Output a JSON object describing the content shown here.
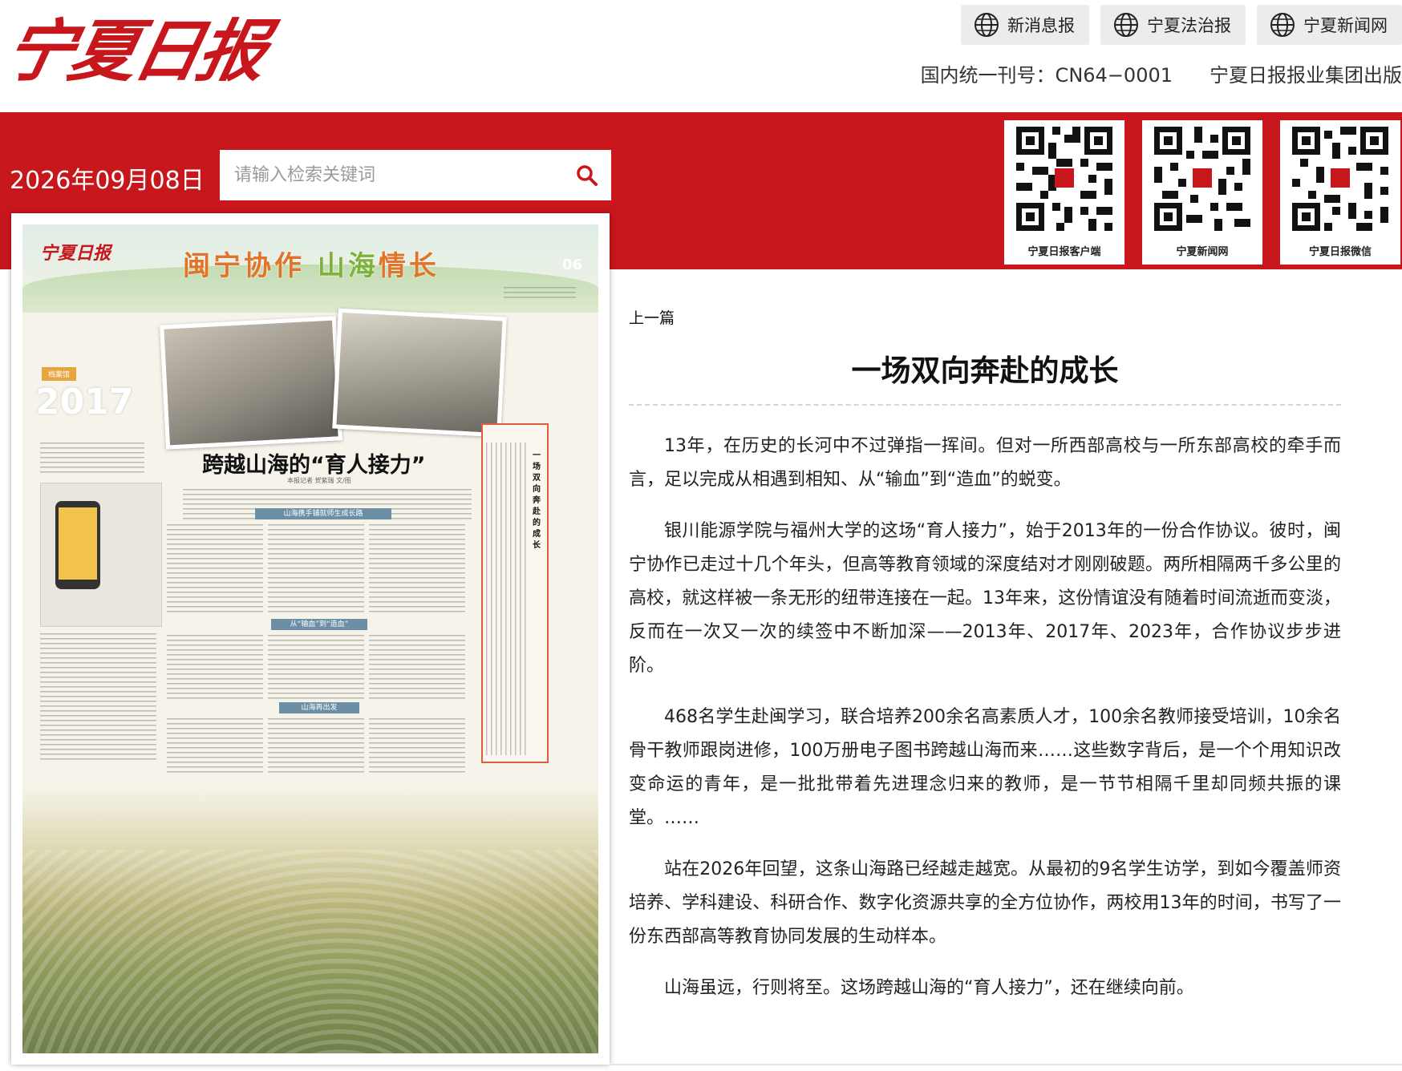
{
  "header": {
    "logo_text": "宁夏日报",
    "top_links": [
      "新消息报",
      "宁夏法治报",
      "宁夏新闻网"
    ],
    "issn": "国内统一刊号：CN64−0001",
    "publisher": "宁夏日报报业集团出版"
  },
  "toolbar": {
    "date": "2026年09月08日",
    "search_placeholder": "请输入检索关键词"
  },
  "qr_codes": [
    {
      "label": "宁夏日报客户端"
    },
    {
      "label": "宁夏新闻网"
    },
    {
      "label": "宁夏日报微信"
    }
  ],
  "paper_page": {
    "masthead": "宁夏日报",
    "banner_a": "闽宁协作",
    "banner_b": "山海",
    "banner_c": "情长",
    "page_no": "06",
    "year": "2017",
    "tag": "档案馆",
    "headline": "跨越山海的“育人接力”",
    "byline": "本报记者 贺紫瑞 文/图",
    "subheads": [
      "山海携手铺就师生成长路",
      "从“输血”到“造血”",
      "山海再出发"
    ],
    "aside_title": "一场双向奔赴的成长"
  },
  "article": {
    "prev_label": "上一篇",
    "title": "一场双向奔赴的成长",
    "paragraphs": [
      "13年，在历史的长河中不过弹指一挥间。但对一所西部高校与一所东部高校的牵手而言，足以完成从相遇到相知、从“输血”到“造血”的蜕变。",
      "银川能源学院与福州大学的这场“育人接力”，始于2013年的一份合作协议。彼时，闽宁协作已走过十几个年头，但高等教育领域的深度结对才刚刚破题。两所相隔两千多公里的高校，就这样被一条无形的纽带连接在一起。13年来，这份情谊没有随着时间流逝而变淡，反而在一次又一次的续签中不断加深——2013年、2017年、2023年，合作协议步步进阶。",
      "468名学生赴闽学习，联合培养200余名高素质人才，100余名教师接受培训，10余名骨干教师跟岗进修，100万册电子图书跨越山海而来……这些数字背后，是一个个用知识改变命运的青年，是一批批带着先进理念归来的教师，是一节节相隔千里却同频共振的课堂。……",
      "站在2026年回望，这条山海路已经越走越宽。从最初的9名学生访学，到如今覆盖师资培养、学科建设、科研合作、数字化资源共享的全方位协作，两校用13年的时间，书写了一份东西部高等教育协同发展的生动样本。",
      "山海虽远，行则将至。这场跨越山海的“育人接力”，还在继续向前。"
    ]
  },
  "colors": {
    "brand_red": "#c8161d",
    "search_icon": "#c8161d"
  },
  "icons": {
    "top_link": "globe-icon",
    "search": "search-icon"
  }
}
